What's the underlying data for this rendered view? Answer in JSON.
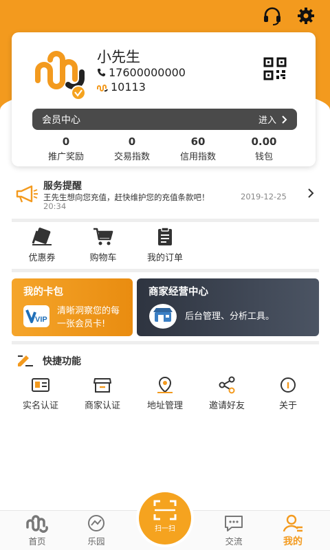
{
  "colors": {
    "accent": "#f39a1e",
    "dark": "#4a4a4a",
    "text": "#333333"
  },
  "header": {
    "headset_icon": "headset-icon",
    "settings_icon": "gear-icon"
  },
  "profile": {
    "name": "小先生",
    "phone": "17600000000",
    "points": "10113",
    "qr_icon": "qr-code-icon"
  },
  "member": {
    "title": "会员中心",
    "enter": "进入"
  },
  "stats": [
    {
      "value": "0",
      "label": "推广奖励"
    },
    {
      "value": "0",
      "label": "交易指数"
    },
    {
      "value": "60",
      "label": "信用指数"
    },
    {
      "value": "0.00",
      "label": "钱包"
    }
  ],
  "notice": {
    "title": "服务提醒",
    "message": "王先生想向您充值，赶快维护您的充值条款吧！",
    "date": "2019-12-25",
    "time": "20:34"
  },
  "quick_links": [
    {
      "label": "优惠券",
      "icon": "coupon-icon"
    },
    {
      "label": "购物车",
      "icon": "cart-icon"
    },
    {
      "label": "我的订单",
      "icon": "order-icon"
    }
  ],
  "wallet_card": {
    "title": "我的卡包",
    "desc_line1": "清晰洞察您的每",
    "desc_line2": "一张会员卡!",
    "badge": "VIP"
  },
  "merchant_card": {
    "title": "商家经营中心",
    "desc": "后台管理、分析工具。"
  },
  "shortcuts": {
    "title": "快捷功能",
    "items": [
      {
        "label": "实名认证",
        "icon": "id-card-icon"
      },
      {
        "label": "商家认证",
        "icon": "store-icon"
      },
      {
        "label": "地址管理",
        "icon": "location-icon"
      },
      {
        "label": "邀请好友",
        "icon": "share-icon"
      },
      {
        "label": "关于",
        "icon": "info-icon"
      }
    ]
  },
  "tabbar": {
    "items": [
      {
        "label": "首页",
        "icon": "home-logo-icon"
      },
      {
        "label": "乐园",
        "icon": "paradise-icon"
      },
      {
        "label": "交流",
        "icon": "chat-icon"
      },
      {
        "label": "我的",
        "icon": "profile-icon"
      }
    ],
    "scan_label": "扫一扫",
    "active": "我的"
  }
}
